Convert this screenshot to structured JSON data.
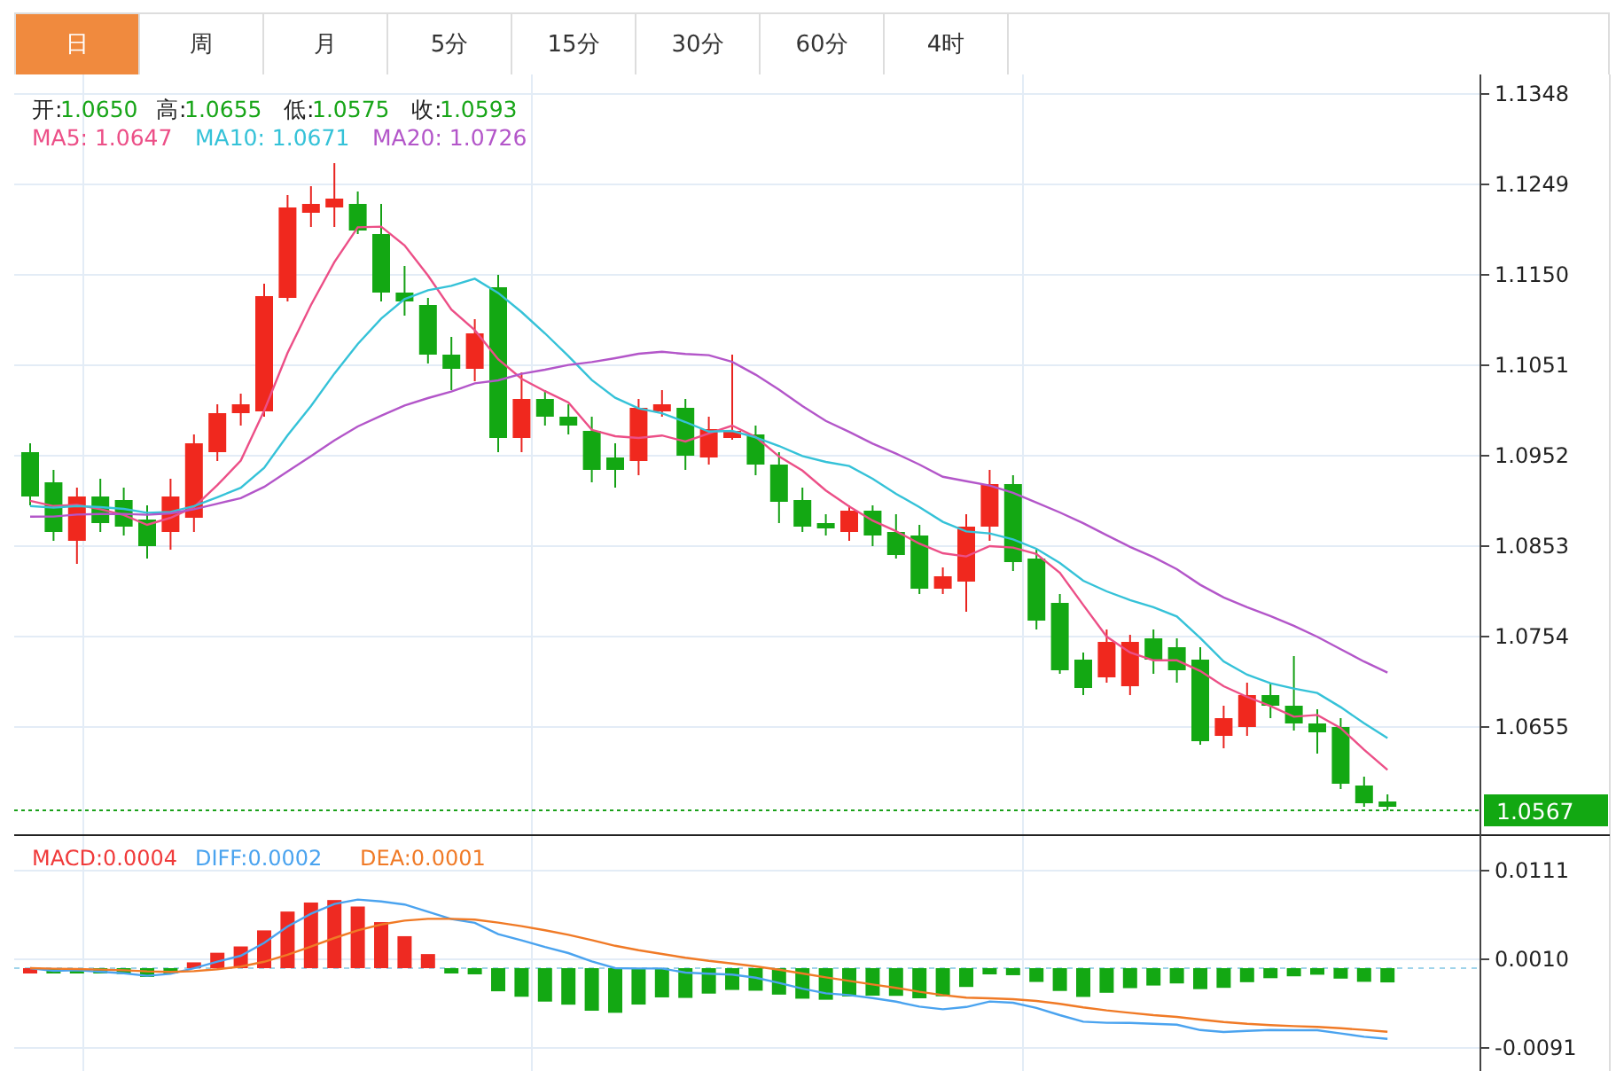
{
  "tabs": [
    {
      "label": "日",
      "selected": true
    },
    {
      "label": "周",
      "selected": false
    },
    {
      "label": "月",
      "selected": false
    },
    {
      "label": "5分",
      "selected": false
    },
    {
      "label": "15分",
      "selected": false
    },
    {
      "label": "30分",
      "selected": false
    },
    {
      "label": "60分",
      "selected": false
    },
    {
      "label": "4时",
      "selected": false
    }
  ],
  "ohlc": [
    {
      "label": "开:",
      "value": "1.0650"
    },
    {
      "label": "高:",
      "value": "1.0655"
    },
    {
      "label": "低:",
      "value": "1.0575"
    },
    {
      "label": "收:",
      "value": "1.0593"
    }
  ],
  "moving_averages": [
    {
      "label": "MA5: 1.0647",
      "color": "#ec4f87"
    },
    {
      "label": "MA10: 1.0671",
      "color": "#35c2d8"
    },
    {
      "label": "MA20: 1.0726",
      "color": "#b356c9"
    }
  ],
  "price_axis": [
    "1.1348",
    "1.1249",
    "1.1150",
    "1.1051",
    "1.0952",
    "1.0853",
    "1.0754",
    "1.0655"
  ],
  "last_price": "1.0567",
  "macd_legend": [
    {
      "label": "MACD:0.0004",
      "color": "#f03a3a"
    },
    {
      "label": "DIFF:0.0002",
      "color": "#4aa3ef"
    },
    {
      "label": "DEA:0.0001",
      "color": "#f07a26"
    }
  ],
  "macd_axis": [
    "0.0111",
    "0.0010",
    "-0.0091"
  ]
}
